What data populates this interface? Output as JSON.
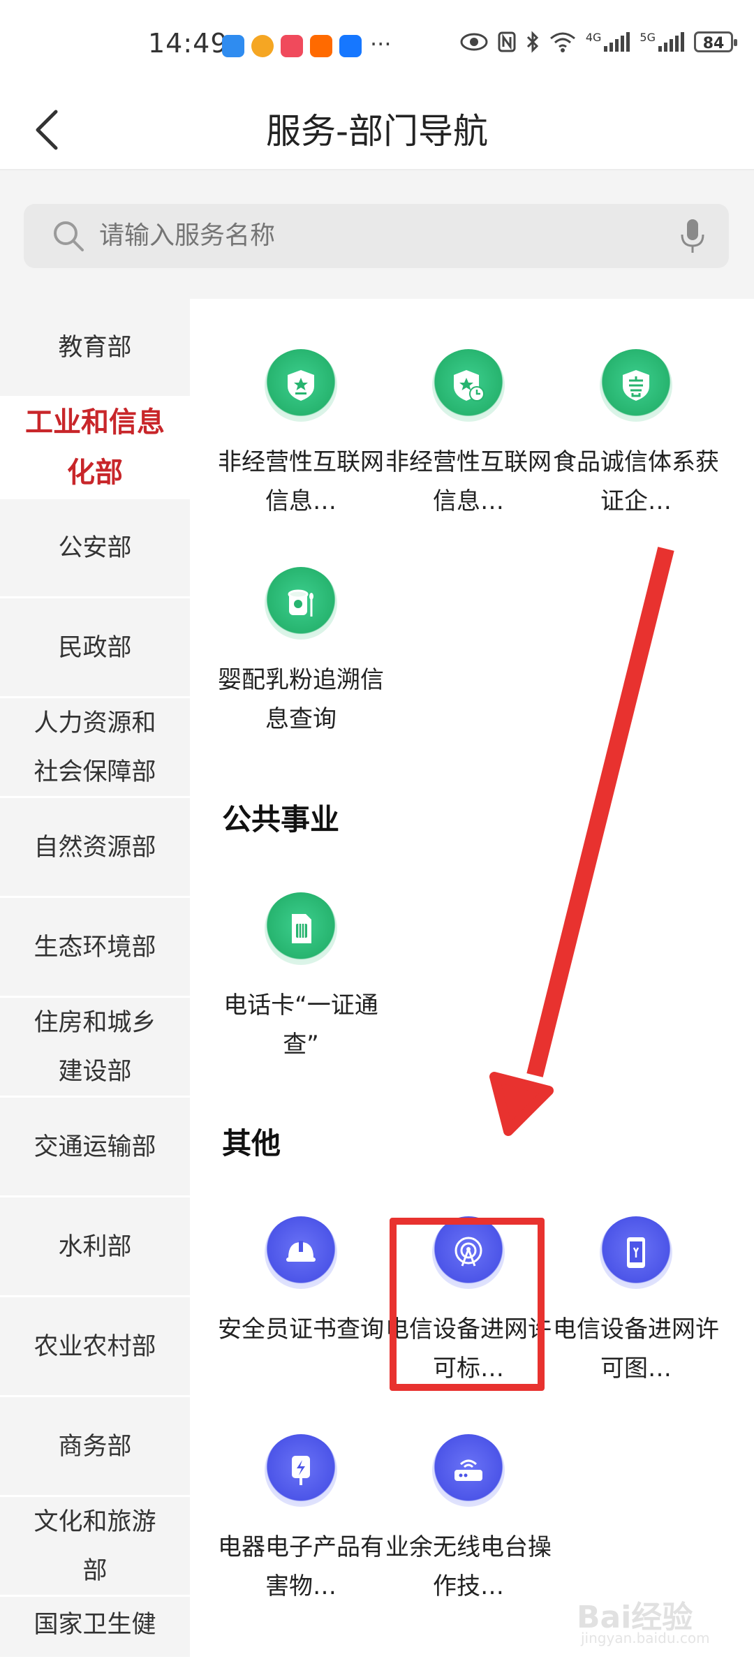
{
  "status_bar": {
    "time": "14:49",
    "more": "···",
    "net1": "4G",
    "net2": "5G",
    "battery": "84"
  },
  "header": {
    "title": "服务-部门导航"
  },
  "search": {
    "placeholder": "请输入服务名称"
  },
  "sidebar": {
    "items": [
      {
        "label": "教育部",
        "active": false
      },
      {
        "label": "工业和信息化部",
        "active": true
      },
      {
        "label": "公安部",
        "active": false
      },
      {
        "label": "民政部",
        "active": false
      },
      {
        "label": "人力资源和社会保障部",
        "active": false
      },
      {
        "label": "自然资源部",
        "active": false
      },
      {
        "label": "生态环境部",
        "active": false
      },
      {
        "label": "住房和城乡建设部",
        "active": false
      },
      {
        "label": "交通运输部",
        "active": false
      },
      {
        "label": "水利部",
        "active": false
      },
      {
        "label": "农业农村部",
        "active": false
      },
      {
        "label": "商务部",
        "active": false
      },
      {
        "label": "文化和旅游部",
        "active": false
      },
      {
        "label": "国家卫生健",
        "active": false
      }
    ]
  },
  "content": {
    "group1": [
      {
        "label": "非经营性互联网信息…",
        "icon": "shield-star-icon"
      },
      {
        "label": "非经营性互联网信息…",
        "icon": "shield-clock-icon"
      },
      {
        "label": "食品诚信体系获证企…",
        "icon": "xin-badge-icon"
      },
      {
        "label": "婴配乳粉追溯信息查询",
        "icon": "milk-can-icon"
      }
    ],
    "section_public": "公共事业",
    "group2": [
      {
        "label": "电话卡“一证通查”",
        "icon": "sim-card-icon"
      }
    ],
    "section_other": "其他",
    "group3": [
      {
        "label": "安全员证书查询",
        "icon": "helmet-icon"
      },
      {
        "label": "电信设备进网许可标…",
        "icon": "antenna-icon"
      },
      {
        "label": "电信设备进网许可图…",
        "icon": "phone-icon"
      },
      {
        "label": "电器电子产品有害物…",
        "icon": "plug-icon"
      },
      {
        "label": "业余无线电台操作技…",
        "icon": "router-icon"
      }
    ]
  },
  "watermark": {
    "text": "Bai经验",
    "sub": "jingyan.baidu.com"
  },
  "colors": {
    "accent_red": "#c8262a",
    "annotation_red": "#e8322f",
    "icon_green": "#27b46f",
    "icon_blue": "#4c55e8"
  }
}
